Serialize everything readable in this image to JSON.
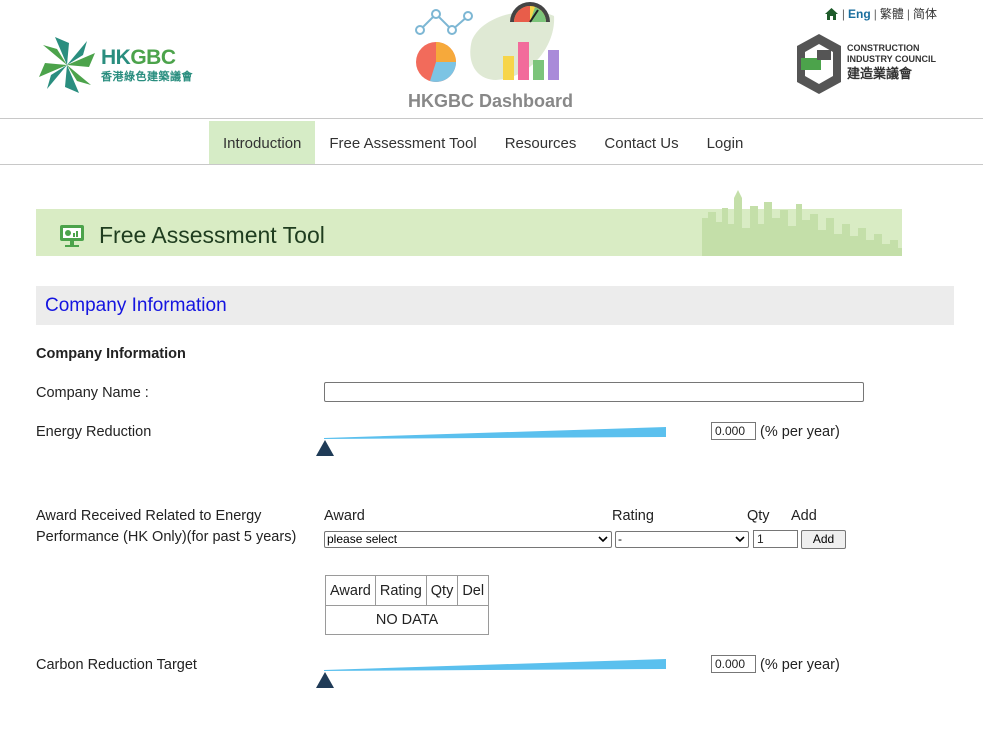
{
  "header": {
    "lang": {
      "eng": "Eng",
      "sep1": "|",
      "trad": "繁體",
      "sep2": "|",
      "simp": "简体"
    },
    "hkgbc_logo": {
      "en_hk": "HK",
      "en_gbc": "GBC",
      "zh": "香港綠色建築議會"
    },
    "dashboard_logo": {
      "title": "HKGBC Dashboard"
    },
    "cic_logo": {
      "line1": "CONSTRUCTION",
      "line2": "INDUSTRY COUNCIL",
      "line3": "建造業議會"
    }
  },
  "nav": {
    "items": [
      {
        "label": "Introduction",
        "active": true
      },
      {
        "label": "Free Assessment Tool",
        "active": false
      },
      {
        "label": "Resources",
        "active": false
      },
      {
        "label": "Contact Us",
        "active": false
      },
      {
        "label": "Login",
        "active": false
      }
    ]
  },
  "banner": {
    "title": "Free Assessment Tool"
  },
  "section": {
    "title": "Company Information"
  },
  "form": {
    "subheading": "Company Information",
    "company_name_label": "Company Name :",
    "company_name_value": "",
    "energy_label": "Energy Reduction",
    "energy_value": "0.000",
    "energy_unit": "(% per year)",
    "award_label_line1": "Award Received Related to Energy",
    "award_label_line2": "Performance (HK Only)(for past 5 years)",
    "col_award": "Award",
    "col_rating": "Rating",
    "col_qty": "Qty",
    "col_add": "Add",
    "award_select": "please select",
    "rating_select": "-",
    "qty_value": "1",
    "add_button": "Add",
    "table_headers": [
      "Award",
      "Rating",
      "Qty",
      "Del"
    ],
    "table_empty": "NO DATA",
    "carbon_label": "Carbon Reduction Target",
    "carbon_value": "0.000",
    "carbon_unit": "(% per year)"
  },
  "colors": {
    "nav_active_bg": "#d6ecc6",
    "banner_bg": "#d9ecc4",
    "section_title": "#1414e0",
    "slider_track": "#5bc0ee",
    "slider_thumb": "#1f3b57"
  }
}
